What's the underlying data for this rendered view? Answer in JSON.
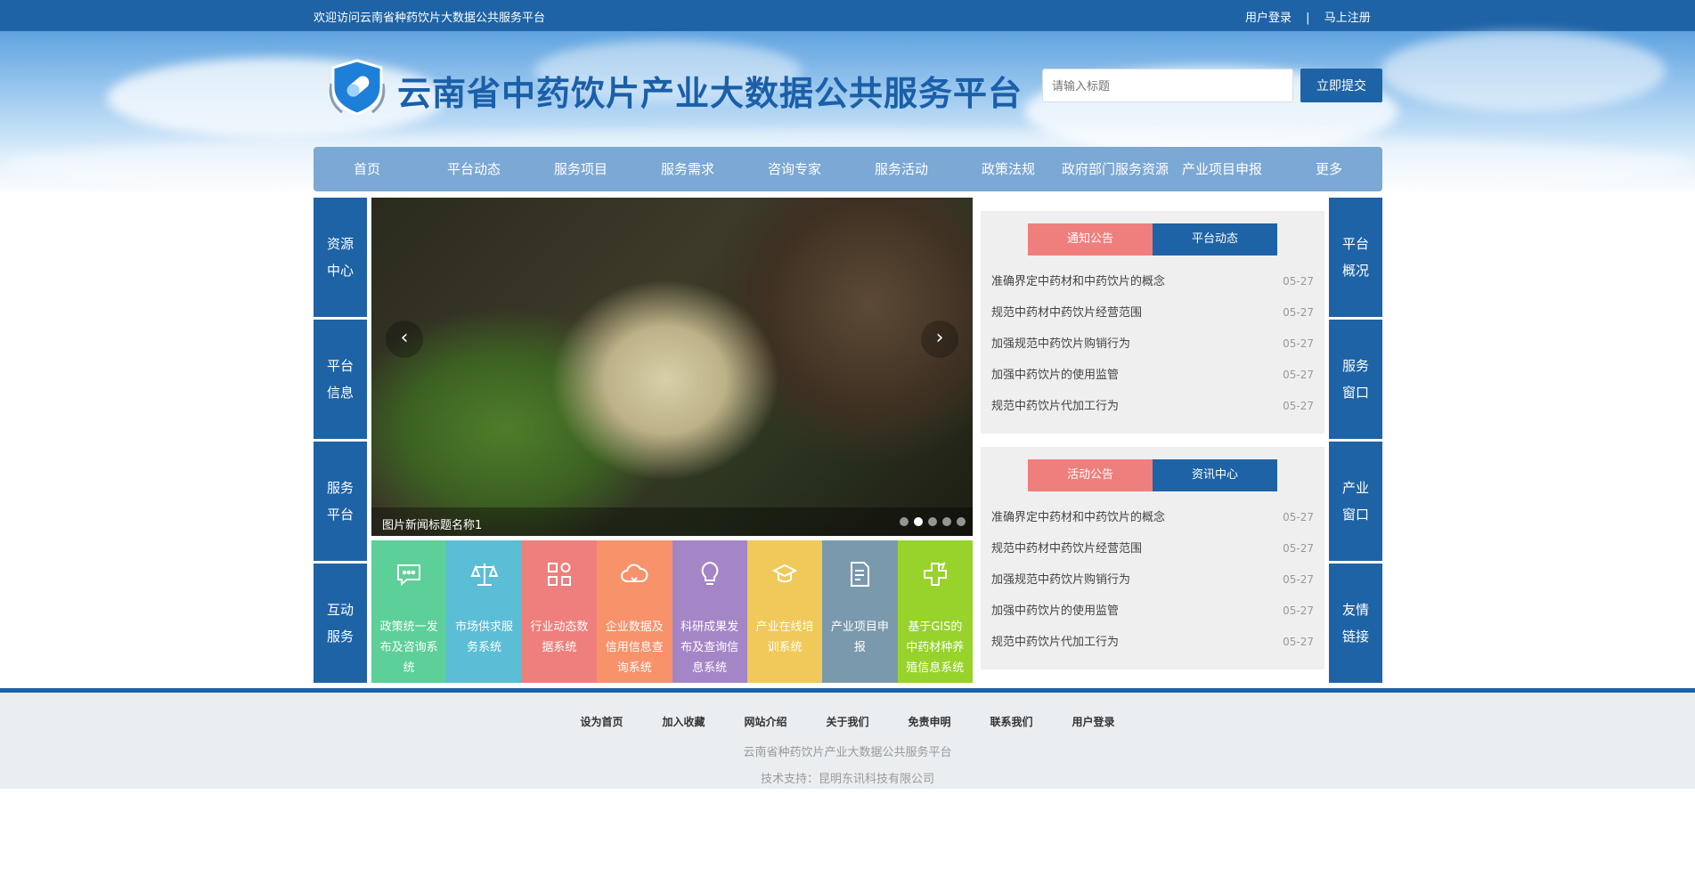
{
  "topbar": {
    "welcome": "欢迎访问云南省种药饮片大数据公共服务平台",
    "login": "用户登录",
    "separator": "|",
    "register": "马上注册"
  },
  "header": {
    "title": "云南省中药饮片产业大数据公共服务平台",
    "search_placeholder": "请输入标题",
    "search_button": "立即提交"
  },
  "nav": [
    "首页",
    "平台动态",
    "服务项目",
    "服务需求",
    "咨询专家",
    "服务活动",
    "政策法规",
    "政府部门服务资源",
    "产业项目申报",
    "更多"
  ],
  "left_side": [
    {
      "line1": "资源",
      "line2": "中心"
    },
    {
      "line1": "平台",
      "line2": "信息"
    },
    {
      "line1": "服务",
      "line2": "平台"
    },
    {
      "line1": "互动",
      "line2": "服务"
    }
  ],
  "right_side": [
    {
      "line1": "平台",
      "line2": "概况"
    },
    {
      "line1": "服务",
      "line2": "窗口"
    },
    {
      "line1": "产业",
      "line2": "窗口"
    },
    {
      "line1": "友情",
      "line2": "链接"
    }
  ],
  "slider": {
    "caption": "图片新闻标题名称1",
    "prev": "‹",
    "next": "›",
    "dot_count": 5,
    "active_dot": 2
  },
  "tiles": [
    {
      "label": "政策统一发布及咨询系统",
      "color": "#5dcf98",
      "icon": "chat-icon"
    },
    {
      "label": "市场供求服务系统",
      "color": "#5bbdd6",
      "icon": "scale-icon"
    },
    {
      "label": "行业动态数据系统",
      "color": "#ef7f7c",
      "icon": "grid-icon"
    },
    {
      "label": "企业数据及信用信息查询系统",
      "color": "#f7926b",
      "icon": "cloud-icon"
    },
    {
      "label": "科研成果发布及查询信息系统",
      "color": "#a486c7",
      "icon": "bulb-icon"
    },
    {
      "label": "产业在线培训系统",
      "color": "#f0c95a",
      "icon": "training-icon"
    },
    {
      "label": "产业项目申报",
      "color": "#7a99ac",
      "icon": "document-icon"
    },
    {
      "label": "基于GIS的中药材种养殖信息系统",
      "color": "#97d32a",
      "icon": "map-icon"
    }
  ],
  "panel1": {
    "tab_left": "通知公告",
    "tab_right": "平台动态",
    "items": [
      {
        "title": "准确界定中药材和中药饮片的概念",
        "date": "05-27"
      },
      {
        "title": "规范中药材中药饮片经营范围",
        "date": "05-27"
      },
      {
        "title": "加强规范中药饮片购销行为",
        "date": "05-27"
      },
      {
        "title": "加强中药饮片的使用监管",
        "date": "05-27"
      },
      {
        "title": "规范中药饮片代加工行为",
        "date": "05-27"
      }
    ]
  },
  "panel2": {
    "tab_left": "活动公告",
    "tab_right": "资讯中心",
    "items": [
      {
        "title": "准确界定中药材和中药饮片的概念",
        "date": "05-27"
      },
      {
        "title": "规范中药材中药饮片经营范围",
        "date": "05-27"
      },
      {
        "title": "加强规范中药饮片购销行为",
        "date": "05-27"
      },
      {
        "title": "加强中药饮片的使用监管",
        "date": "05-27"
      },
      {
        "title": "规范中药饮片代加工行为",
        "date": "05-27"
      }
    ]
  },
  "footer": {
    "links": [
      "设为首页",
      "加入收藏",
      "网站介绍",
      "关于我们",
      "免责申明",
      "联系我们",
      "用户登录"
    ],
    "line1": "云南省种药饮片产业大数据公共服务平台",
    "line2": "技术支持：昆明东讯科技有限公司"
  },
  "colors": {
    "brand": "#1e63a6",
    "tab_active": "#ef7f7c"
  }
}
